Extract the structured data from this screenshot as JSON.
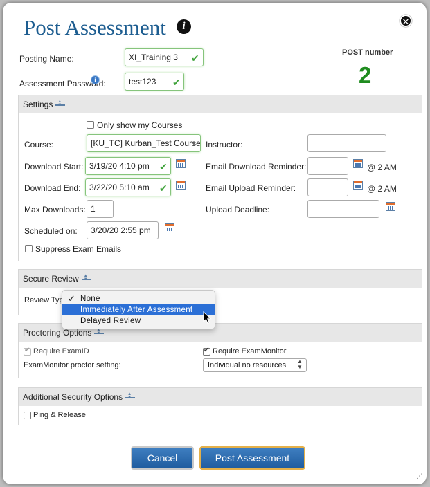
{
  "dialog": {
    "title": "Post Assessment",
    "info_icon": "info-icon",
    "close_icon": "close-icon"
  },
  "header": {
    "posting_name_label": "Posting Name:",
    "posting_name_value": "XI_Training 3",
    "password_label": "Assessment Password:",
    "password_value": "test123",
    "post_number_label": "POST number",
    "post_number_value": "2",
    "post_number_color": "#1f8c1f"
  },
  "settings": {
    "title": "Settings",
    "only_my_courses": "Only show my Courses",
    "course_label": "Course:",
    "course_value": "[KU_TC] Kurban_Test Course",
    "instructor_label": "Instructor:",
    "instructor_value": "",
    "download_start_label": "Download Start:",
    "download_start_value": "3/19/20 4:10 pm",
    "email_download_label": "Email Download Reminder:",
    "email_download_value": "",
    "email_download_suffix": "@ 2 AM",
    "download_end_label": "Download End:",
    "download_end_value": "3/22/20 5:10 am",
    "email_upload_label": "Email Upload Reminder:",
    "email_upload_value": "",
    "email_upload_suffix": "@ 2 AM",
    "max_downloads_label": "Max Downloads:",
    "max_downloads_value": "1",
    "upload_deadline_label": "Upload Deadline:",
    "upload_deadline_value": "",
    "scheduled_label": "Scheduled on:",
    "scheduled_value": "3/20/20 2:55 pm",
    "suppress_emails": "Suppress Exam Emails"
  },
  "secure_review": {
    "title": "Secure Review",
    "review_type_label": "Review Type",
    "options": [
      "None",
      "Immediately After Assessment",
      "Delayed Review"
    ],
    "checked_option": "None",
    "highlighted_option": "Immediately After Assessment"
  },
  "proctoring": {
    "title": "Proctoring Options",
    "require_examid": "Require ExamID",
    "require_exammonitor": "Require ExamMonitor",
    "proctor_setting_label": "ExamMonitor proctor setting:",
    "proctor_setting_value": "Individual no resources"
  },
  "additional_security": {
    "title": "Additional Security Options",
    "ping_release": "Ping & Release"
  },
  "footer": {
    "cancel_label": "Cancel",
    "post_label": "Post Assessment"
  },
  "colors": {
    "title": "#1d5d90",
    "button": "#2a6bb0",
    "valid_border": "#86c47c",
    "highlight": "#2b6fd6"
  }
}
